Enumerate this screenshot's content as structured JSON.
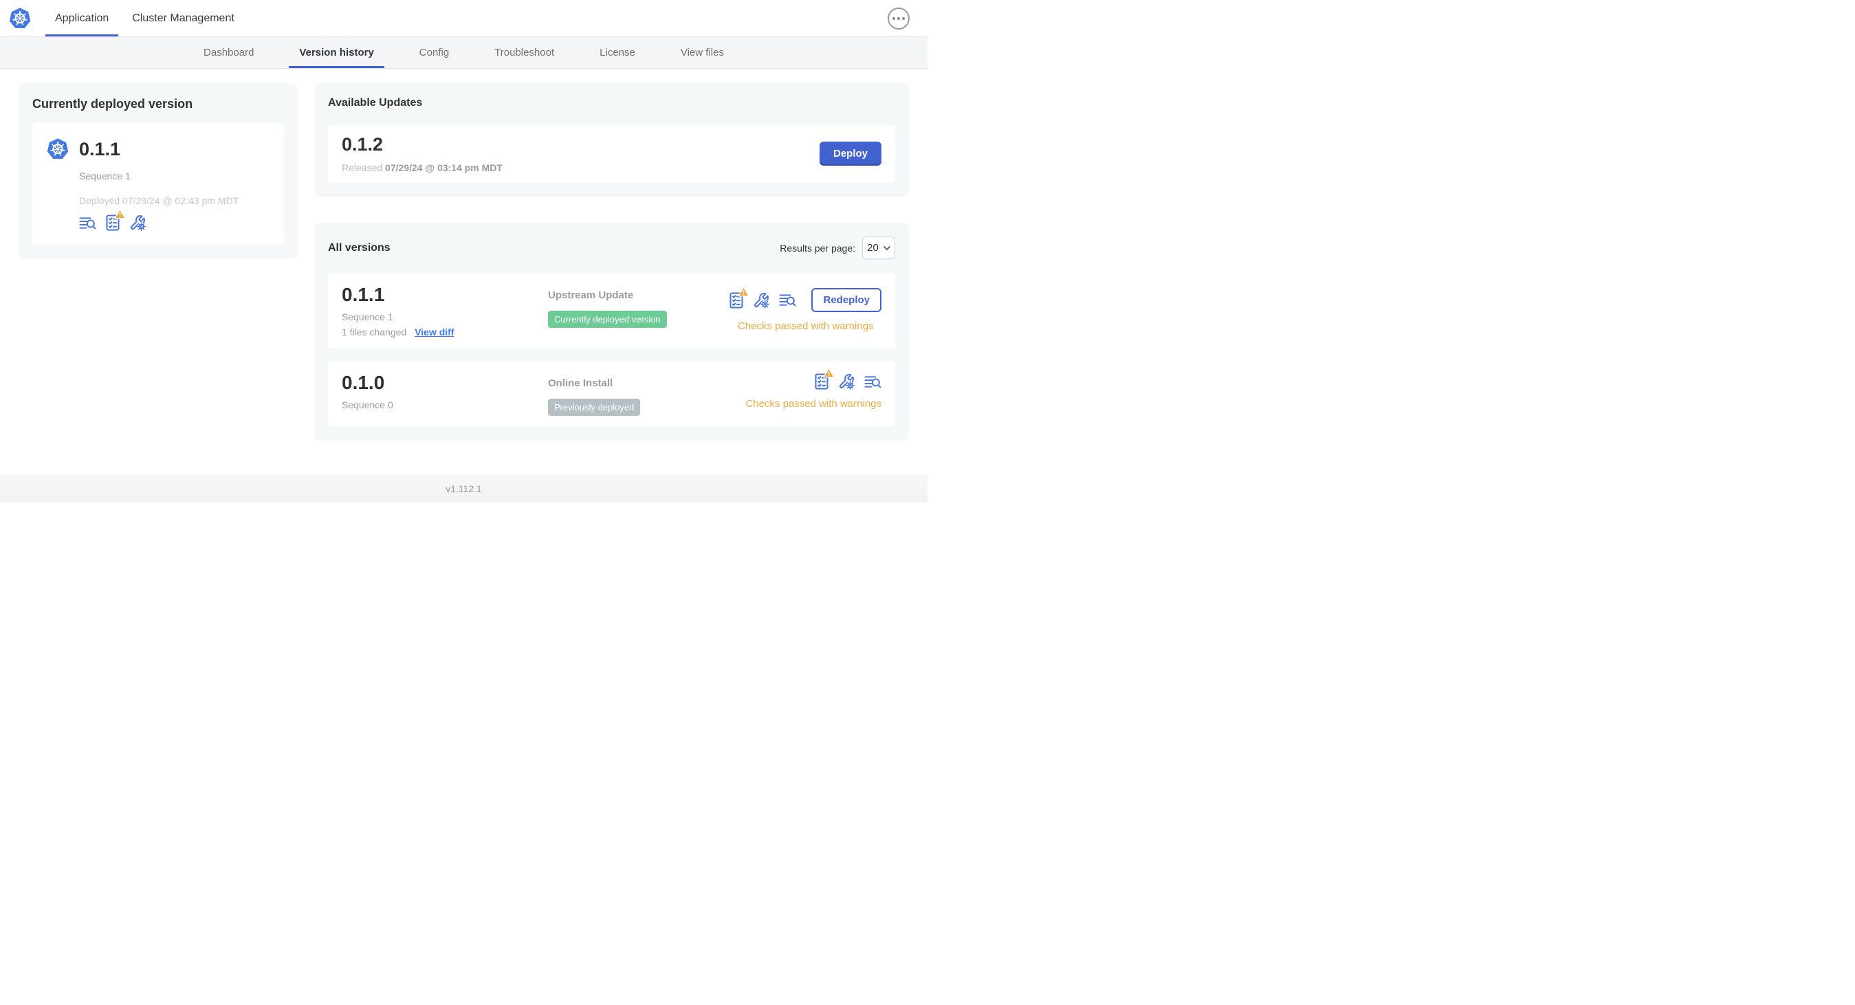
{
  "header": {
    "app_tab": "Application",
    "cluster_tab": "Cluster Management"
  },
  "subnav": {
    "tabs": [
      {
        "label": "Dashboard",
        "active": false
      },
      {
        "label": "Version history",
        "active": true
      },
      {
        "label": "Config",
        "active": false
      },
      {
        "label": "Troubleshoot",
        "active": false
      },
      {
        "label": "License",
        "active": false
      },
      {
        "label": "View files",
        "active": false
      }
    ]
  },
  "current_version_card": {
    "title": "Currently deployed version",
    "version": "0.1.1",
    "sequence": "Sequence 1",
    "deployed": "Deployed 07/29/24 @ 02:43 pm MDT"
  },
  "available_updates": {
    "title": "Available Updates",
    "version": "0.1.2",
    "released_label": "Released",
    "released_date": "07/29/24 @ 03:14 pm MDT",
    "deploy_button": "Deploy"
  },
  "all_versions": {
    "title": "All versions",
    "results_per_page_label": "Results per page:",
    "results_per_page_value": "20",
    "rows": [
      {
        "version": "0.1.1",
        "sequence": "Sequence 1",
        "files_changed": "1 files changed",
        "view_diff": "View diff",
        "source_type": "Upstream Update",
        "badge_label": "Currently deployed version",
        "status_text": "Checks passed with warnings",
        "action_button": "Redeploy"
      },
      {
        "version": "0.1.0",
        "sequence": "Sequence 0",
        "source_type": "Online Install",
        "badge_label": "Previously deployed",
        "status_text": "Checks passed with warnings"
      }
    ]
  },
  "footer": {
    "app_version": "v1.112.1"
  },
  "colors": {
    "primary_blue": "#4263cf",
    "icon_blue": "#4673e0",
    "link_blue": "#3d79f2",
    "badge_green": "#6dcb96",
    "badge_gray": "#b6c0c4",
    "warning_amber": "#ecab3f",
    "kubernetes_blue": "#4579e2"
  }
}
